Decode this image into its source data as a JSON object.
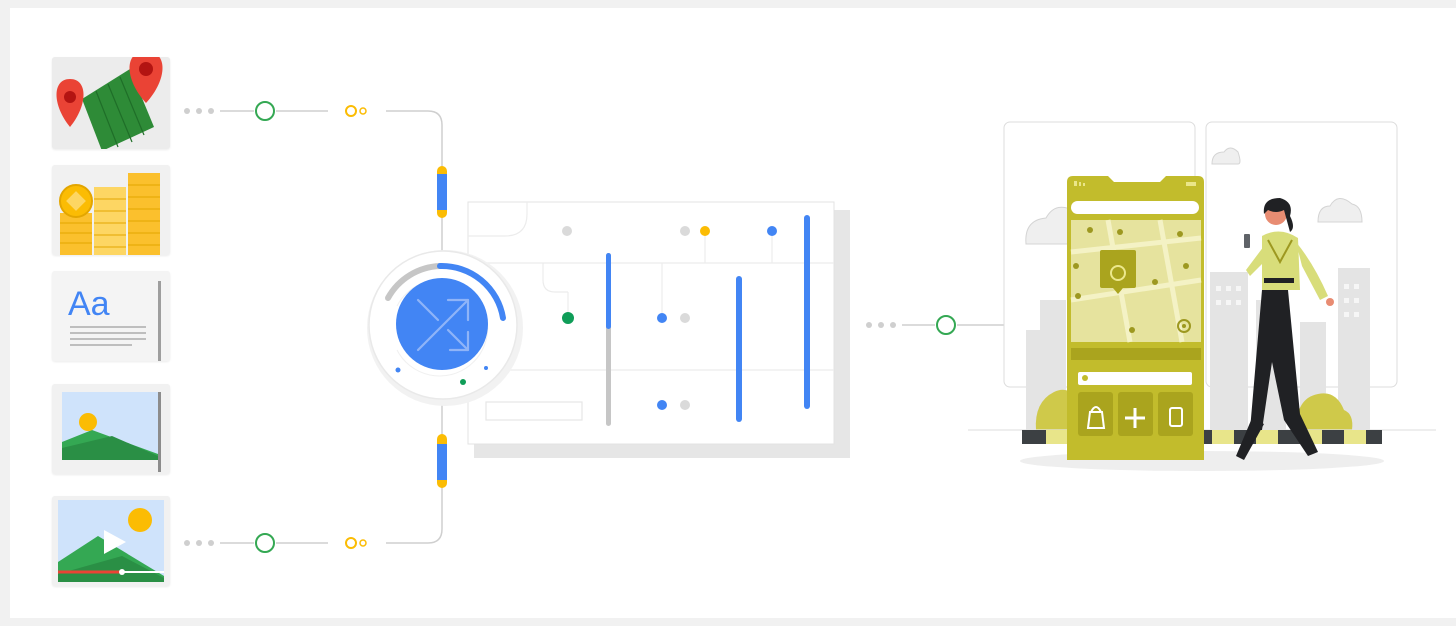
{
  "inputs": {
    "items": [
      {
        "name": "map"
      },
      {
        "name": "coins"
      },
      {
        "name": "text",
        "label": "Aa"
      },
      {
        "name": "image"
      },
      {
        "name": "video"
      }
    ]
  },
  "colors": {
    "blue": "#4285f4",
    "green": "#34a853",
    "yellow": "#fbbc04",
    "red": "#ea4335",
    "gray": "#bdbdbd",
    "olive": "#c2bc2c"
  },
  "icons": [
    "map-pin-icon",
    "coins-icon",
    "text-document-icon",
    "image-icon",
    "video-icon",
    "shuffle-icon",
    "restaurant-icon",
    "shopping-bag-icon",
    "medical-plus-icon",
    "fuel-icon",
    "location-target-icon",
    "cloud-icon"
  ]
}
